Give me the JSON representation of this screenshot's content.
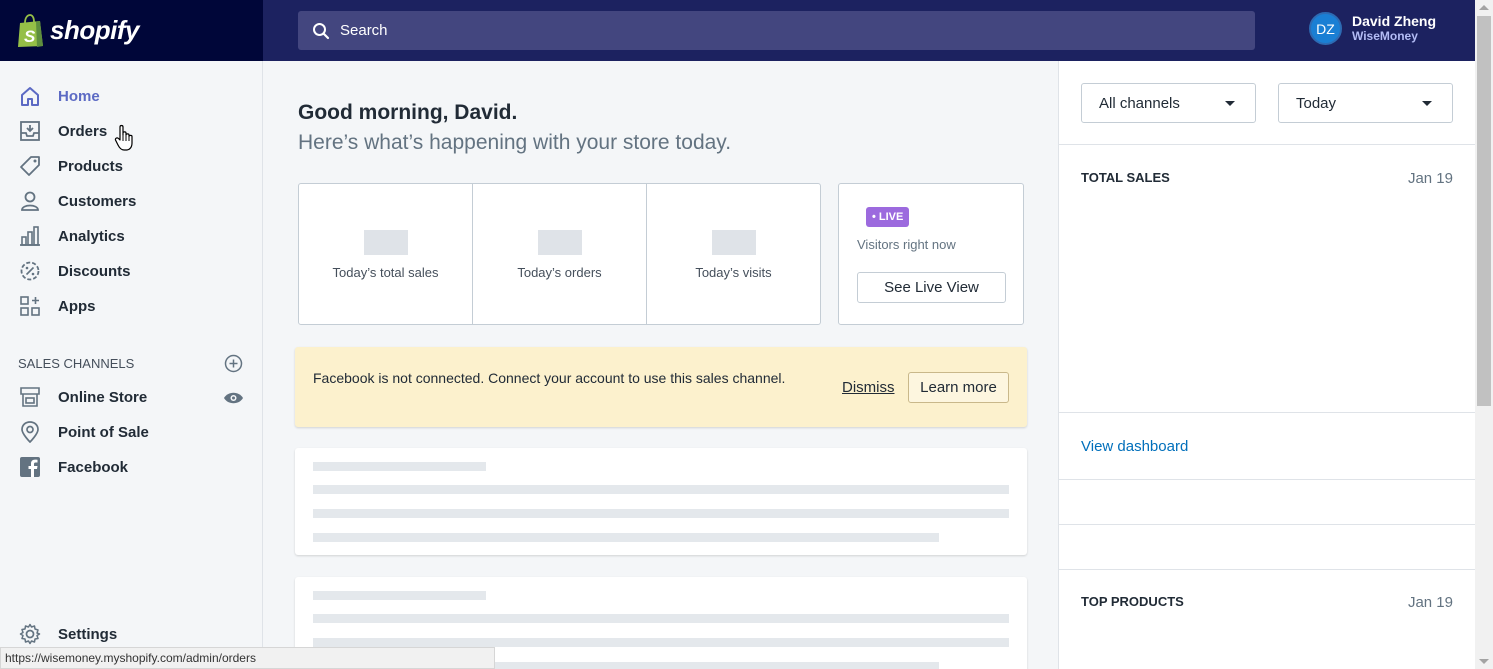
{
  "brand": {
    "name": "shopify"
  },
  "search": {
    "placeholder": "Search"
  },
  "user": {
    "initials": "DZ",
    "name": "David Zheng",
    "store": "WiseMoney"
  },
  "sidebar": {
    "items": [
      {
        "label": "Home",
        "icon": "home-icon"
      },
      {
        "label": "Orders",
        "icon": "orders-icon"
      },
      {
        "label": "Products",
        "icon": "tag-icon"
      },
      {
        "label": "Customers",
        "icon": "person-icon"
      },
      {
        "label": "Analytics",
        "icon": "chart-icon"
      },
      {
        "label": "Discounts",
        "icon": "discount-icon"
      },
      {
        "label": "Apps",
        "icon": "apps-icon"
      }
    ],
    "sales_channels_title": "SALES CHANNELS",
    "channels": [
      {
        "label": "Online Store",
        "icon": "store-icon"
      },
      {
        "label": "Point of Sale",
        "icon": "location-pin-icon"
      },
      {
        "label": "Facebook",
        "icon": "facebook-icon"
      }
    ],
    "settings": "Settings"
  },
  "main": {
    "greeting": "Good morning, David.",
    "subtitle": "Here’s what’s happening with your store today.",
    "stats": [
      {
        "label": "Today’s total sales"
      },
      {
        "label": "Today’s orders"
      },
      {
        "label": "Today’s visits"
      }
    ],
    "live": {
      "badge": "• LIVE",
      "text": "Visitors right now",
      "button": "See Live View"
    },
    "banner": {
      "text": "Facebook is not connected. Connect your account to use this sales channel.",
      "dismiss": "Dismiss",
      "learn_more": "Learn more"
    }
  },
  "right_panel": {
    "channel_select": "All channels",
    "date_select": "Today",
    "total_sales": {
      "title": "TOTAL SALES",
      "date": "Jan 19"
    },
    "view_dashboard": "View dashboard",
    "top_products": {
      "title": "TOP PRODUCTS",
      "date": "Jan 19"
    }
  },
  "statusbar": {
    "url": "https://wisemoney.myshopify.com/admin/orders"
  },
  "colors": {
    "accent": "#5c6ac4",
    "topbar": "#1c2260",
    "live_badge": "#9c6ade",
    "banner": "#fcf1cd",
    "link": "#006fbb"
  }
}
